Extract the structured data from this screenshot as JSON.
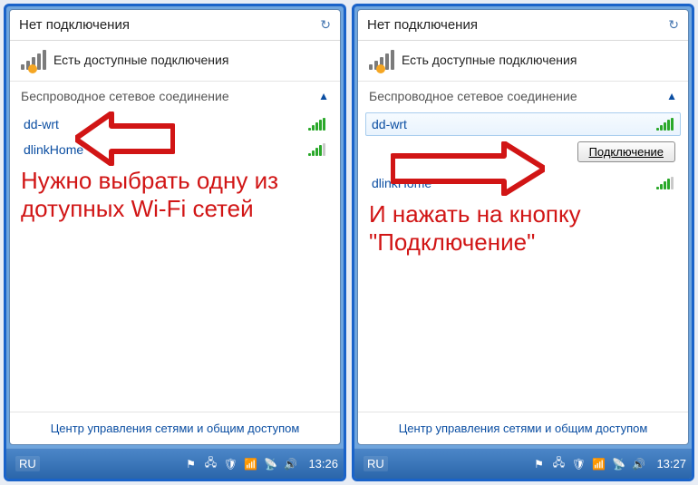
{
  "panels": [
    {
      "title": "Нет подключения",
      "status": "Есть доступные подключения",
      "section": "Беспроводное сетевое соединение",
      "networks": [
        {
          "name": "dd-wrt",
          "signal": "full",
          "selected": false
        },
        {
          "name": "dlinkHome",
          "signal": "partial",
          "selected": false
        }
      ],
      "showConnect": false,
      "annotation": "Нужно выбрать одну из дотупных Wi-Fi сетей",
      "footer": "Центр управления сетями и общим доступом",
      "taskbar": {
        "lang": "RU",
        "clock": "13:26"
      }
    },
    {
      "title": "Нет подключения",
      "status": "Есть доступные подключения",
      "section": "Беспроводное сетевое соединение",
      "networks": [
        {
          "name": "dd-wrt",
          "signal": "full",
          "selected": true
        },
        {
          "name": "dlinkHome",
          "signal": "partial",
          "selected": false
        }
      ],
      "showConnect": true,
      "connectLabel": "Подключение",
      "annotation": "И нажать на кнопку \"Подключение\"",
      "footer": "Центр управления сетями и общим доступом",
      "taskbar": {
        "lang": "RU",
        "clock": "13:27"
      }
    }
  ]
}
